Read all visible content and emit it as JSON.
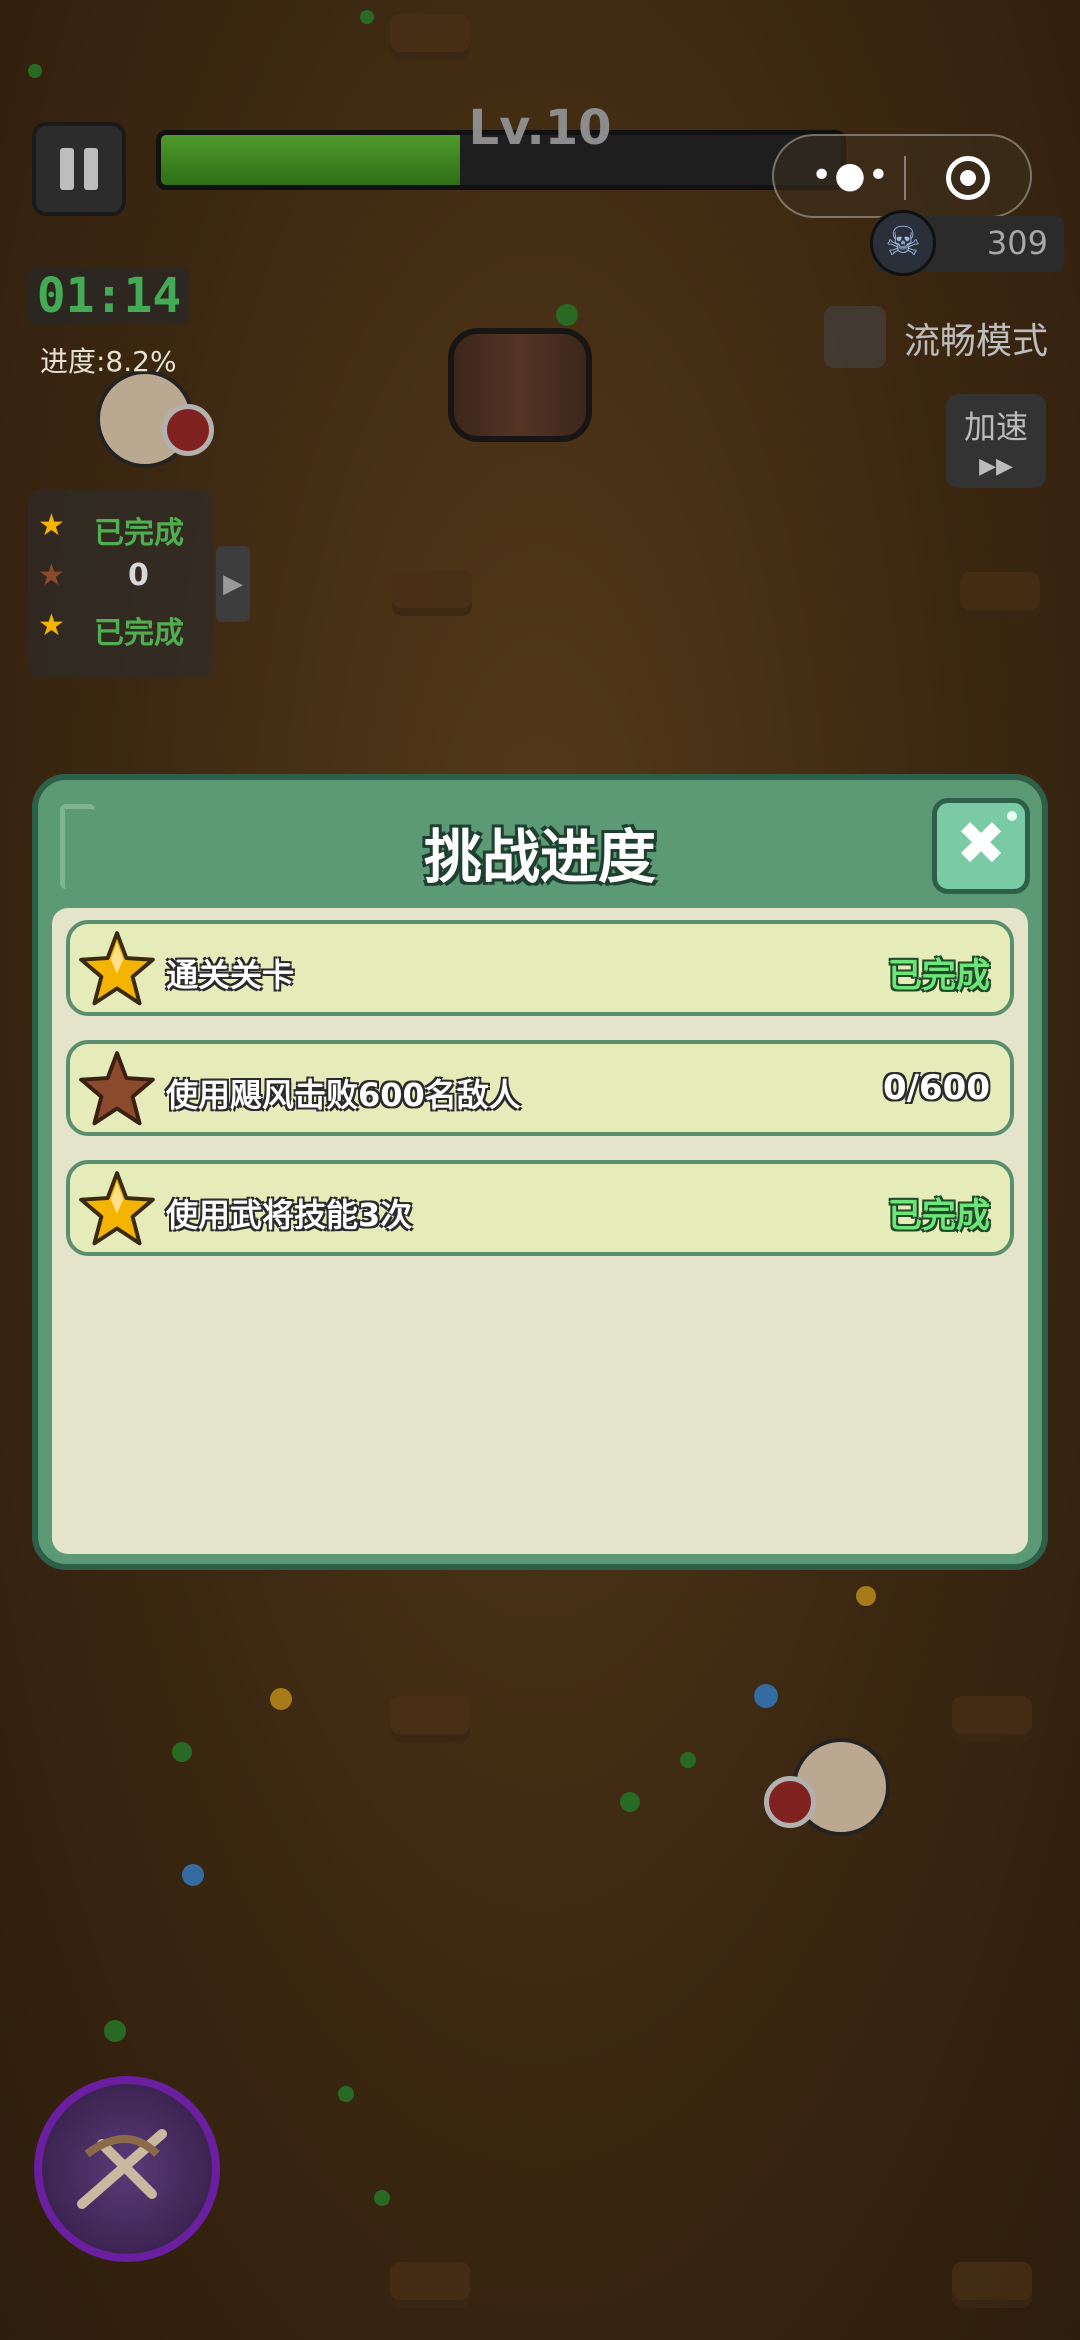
{
  "hud": {
    "level": "Lv.10",
    "xp_progress": 0.44,
    "kill_count": "309",
    "timer": "01:14",
    "progress_text": "进度:8.2%",
    "smooth_mode_label": "流畅模式",
    "speed_up_label": "加速",
    "speed_up_arrows": "▶▶",
    "wechat_more": "•●•",
    "side_tasks": [
      {
        "star_color": "gold",
        "text": "已完成"
      },
      {
        "star_color": "bronze",
        "text": "0"
      },
      {
        "star_color": "gold",
        "text": "已完成"
      }
    ],
    "side_arrow": "▶"
  },
  "dialog": {
    "title": "挑战进度",
    "close_glyph": "✖",
    "tasks": [
      {
        "label": "通关关卡",
        "status": "已完成",
        "star_color": "gold"
      },
      {
        "label": "使用飓风击败600名敌人",
        "status": "0/600",
        "star_color": "bronze"
      },
      {
        "label": "使用武将技能3次",
        "status": "已完成",
        "star_color": "gold"
      }
    ]
  },
  "icons": {
    "skull": "☠",
    "star": "★"
  },
  "colors": {
    "gold_star": "#f4b400",
    "bronze_star": "#8b4a2b",
    "done_green": "#6ee57a",
    "dialog_green": "#5c9a76"
  }
}
